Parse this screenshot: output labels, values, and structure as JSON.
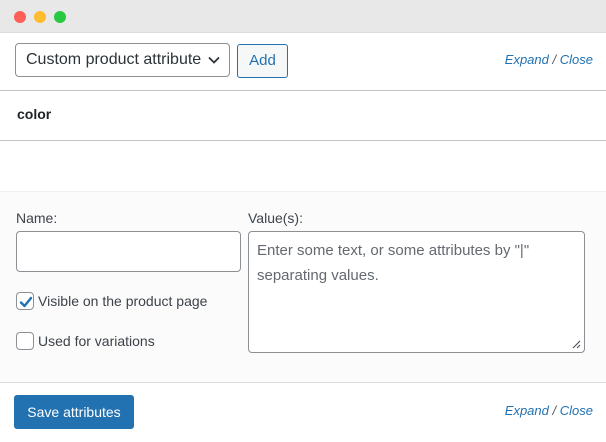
{
  "window": {
    "controls": [
      "close",
      "minimize",
      "maximize"
    ]
  },
  "toolbar": {
    "attribute_select_value": "Custom product attribute",
    "add_label": "Add",
    "expand_label": "Expand",
    "separator": "/",
    "close_label": "Close"
  },
  "attribute": {
    "name": "color",
    "name_label": "Name:",
    "name_value": "",
    "values_label": "Value(s):",
    "values_placeholder": "Enter some text, or some attributes by \"|\" separating values.",
    "visible_label": "Visible on the product page",
    "visible_checked": true,
    "variations_label": "Used for variations",
    "variations_checked": false
  },
  "footer": {
    "save_label": "Save attributes",
    "expand_label": "Expand",
    "separator": "/",
    "close_label": "Close"
  },
  "colors": {
    "accent": "#2271b1",
    "close_dot": "#fe5f57",
    "minimize_dot": "#febc2e",
    "maximize_dot": "#28c840"
  }
}
